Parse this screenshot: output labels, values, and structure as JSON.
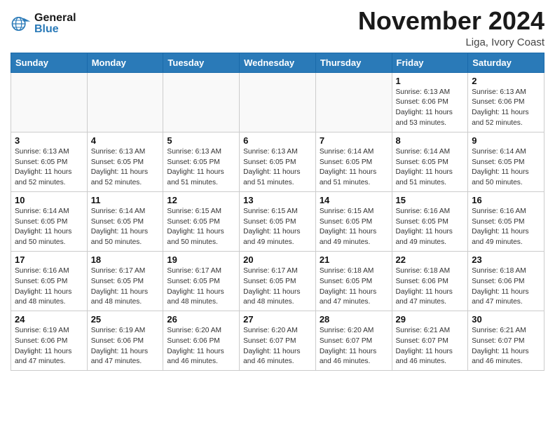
{
  "header": {
    "logo_general": "General",
    "logo_blue": "Blue",
    "month": "November 2024",
    "location": "Liga, Ivory Coast"
  },
  "days_of_week": [
    "Sunday",
    "Monday",
    "Tuesday",
    "Wednesday",
    "Thursday",
    "Friday",
    "Saturday"
  ],
  "weeks": [
    [
      {
        "day": "",
        "info": ""
      },
      {
        "day": "",
        "info": ""
      },
      {
        "day": "",
        "info": ""
      },
      {
        "day": "",
        "info": ""
      },
      {
        "day": "",
        "info": ""
      },
      {
        "day": "1",
        "info": "Sunrise: 6:13 AM\nSunset: 6:06 PM\nDaylight: 11 hours\nand 53 minutes."
      },
      {
        "day": "2",
        "info": "Sunrise: 6:13 AM\nSunset: 6:06 PM\nDaylight: 11 hours\nand 52 minutes."
      }
    ],
    [
      {
        "day": "3",
        "info": "Sunrise: 6:13 AM\nSunset: 6:05 PM\nDaylight: 11 hours\nand 52 minutes."
      },
      {
        "day": "4",
        "info": "Sunrise: 6:13 AM\nSunset: 6:05 PM\nDaylight: 11 hours\nand 52 minutes."
      },
      {
        "day": "5",
        "info": "Sunrise: 6:13 AM\nSunset: 6:05 PM\nDaylight: 11 hours\nand 51 minutes."
      },
      {
        "day": "6",
        "info": "Sunrise: 6:13 AM\nSunset: 6:05 PM\nDaylight: 11 hours\nand 51 minutes."
      },
      {
        "day": "7",
        "info": "Sunrise: 6:14 AM\nSunset: 6:05 PM\nDaylight: 11 hours\nand 51 minutes."
      },
      {
        "day": "8",
        "info": "Sunrise: 6:14 AM\nSunset: 6:05 PM\nDaylight: 11 hours\nand 51 minutes."
      },
      {
        "day": "9",
        "info": "Sunrise: 6:14 AM\nSunset: 6:05 PM\nDaylight: 11 hours\nand 50 minutes."
      }
    ],
    [
      {
        "day": "10",
        "info": "Sunrise: 6:14 AM\nSunset: 6:05 PM\nDaylight: 11 hours\nand 50 minutes."
      },
      {
        "day": "11",
        "info": "Sunrise: 6:14 AM\nSunset: 6:05 PM\nDaylight: 11 hours\nand 50 minutes."
      },
      {
        "day": "12",
        "info": "Sunrise: 6:15 AM\nSunset: 6:05 PM\nDaylight: 11 hours\nand 50 minutes."
      },
      {
        "day": "13",
        "info": "Sunrise: 6:15 AM\nSunset: 6:05 PM\nDaylight: 11 hours\nand 49 minutes."
      },
      {
        "day": "14",
        "info": "Sunrise: 6:15 AM\nSunset: 6:05 PM\nDaylight: 11 hours\nand 49 minutes."
      },
      {
        "day": "15",
        "info": "Sunrise: 6:16 AM\nSunset: 6:05 PM\nDaylight: 11 hours\nand 49 minutes."
      },
      {
        "day": "16",
        "info": "Sunrise: 6:16 AM\nSunset: 6:05 PM\nDaylight: 11 hours\nand 49 minutes."
      }
    ],
    [
      {
        "day": "17",
        "info": "Sunrise: 6:16 AM\nSunset: 6:05 PM\nDaylight: 11 hours\nand 48 minutes."
      },
      {
        "day": "18",
        "info": "Sunrise: 6:17 AM\nSunset: 6:05 PM\nDaylight: 11 hours\nand 48 minutes."
      },
      {
        "day": "19",
        "info": "Sunrise: 6:17 AM\nSunset: 6:05 PM\nDaylight: 11 hours\nand 48 minutes."
      },
      {
        "day": "20",
        "info": "Sunrise: 6:17 AM\nSunset: 6:05 PM\nDaylight: 11 hours\nand 48 minutes."
      },
      {
        "day": "21",
        "info": "Sunrise: 6:18 AM\nSunset: 6:05 PM\nDaylight: 11 hours\nand 47 minutes."
      },
      {
        "day": "22",
        "info": "Sunrise: 6:18 AM\nSunset: 6:06 PM\nDaylight: 11 hours\nand 47 minutes."
      },
      {
        "day": "23",
        "info": "Sunrise: 6:18 AM\nSunset: 6:06 PM\nDaylight: 11 hours\nand 47 minutes."
      }
    ],
    [
      {
        "day": "24",
        "info": "Sunrise: 6:19 AM\nSunset: 6:06 PM\nDaylight: 11 hours\nand 47 minutes."
      },
      {
        "day": "25",
        "info": "Sunrise: 6:19 AM\nSunset: 6:06 PM\nDaylight: 11 hours\nand 47 minutes."
      },
      {
        "day": "26",
        "info": "Sunrise: 6:20 AM\nSunset: 6:06 PM\nDaylight: 11 hours\nand 46 minutes."
      },
      {
        "day": "27",
        "info": "Sunrise: 6:20 AM\nSunset: 6:07 PM\nDaylight: 11 hours\nand 46 minutes."
      },
      {
        "day": "28",
        "info": "Sunrise: 6:20 AM\nSunset: 6:07 PM\nDaylight: 11 hours\nand 46 minutes."
      },
      {
        "day": "29",
        "info": "Sunrise: 6:21 AM\nSunset: 6:07 PM\nDaylight: 11 hours\nand 46 minutes."
      },
      {
        "day": "30",
        "info": "Sunrise: 6:21 AM\nSunset: 6:07 PM\nDaylight: 11 hours\nand 46 minutes."
      }
    ]
  ]
}
